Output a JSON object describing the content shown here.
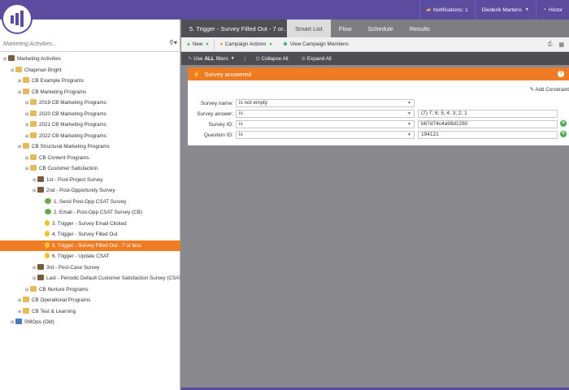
{
  "app": {
    "notifications_label": "Notifications: 1",
    "user_name": "Diederik Martens",
    "history_label": "Histor"
  },
  "left": {
    "search_placeholder": "Marketing Activities...",
    "tree": [
      {
        "label": "Marketing Activities",
        "indent": 0,
        "icon": "root"
      },
      {
        "label": "Chapman Bright",
        "indent": 1,
        "icon": "folder"
      },
      {
        "label": "CB Example Programs",
        "indent": 2,
        "icon": "folder"
      },
      {
        "label": "CB Marketing Programs",
        "indent": 2,
        "icon": "folder"
      },
      {
        "label": "2019 CB Marketing Programs",
        "indent": 3,
        "icon": "folder"
      },
      {
        "label": "2020 CB Marketing Programs",
        "indent": 3,
        "icon": "folder"
      },
      {
        "label": "2021 CB Marketing Programs",
        "indent": 3,
        "icon": "folder"
      },
      {
        "label": "2022 CB Marketing Programs",
        "indent": 3,
        "icon": "folder"
      },
      {
        "label": "CB Structural Marketing Programs",
        "indent": 2,
        "icon": "folder"
      },
      {
        "label": "CB Content Programs",
        "indent": 3,
        "icon": "folder"
      },
      {
        "label": "CB Customer Satisfaction",
        "indent": 3,
        "icon": "folder"
      },
      {
        "label": "1st - Post-Project Survey",
        "indent": 4,
        "icon": "program"
      },
      {
        "label": "2nd - Post-Opportunity Survey",
        "indent": 4,
        "icon": "program"
      },
      {
        "label": "1. Send Post-Opp CSAT Survey",
        "indent": 5,
        "icon": "email"
      },
      {
        "label": "2. Email - Post-Opp CSAT Survey (CB)",
        "indent": 5,
        "icon": "email"
      },
      {
        "label": "3. Trigger - Survey Email Clicked",
        "indent": 5,
        "icon": "bulb"
      },
      {
        "label": "4. Trigger - Survey Filled Out",
        "indent": 5,
        "icon": "bulb"
      },
      {
        "label": "5. Trigger - Survey Filled Out - 7 or less",
        "indent": 5,
        "icon": "bulb",
        "selected": true
      },
      {
        "label": "6. Trigger - Update CSAT",
        "indent": 5,
        "icon": "bulb"
      },
      {
        "label": "3rd - Post-Case Survey",
        "indent": 4,
        "icon": "program"
      },
      {
        "label": "Last - Periodic Default Customer Satisfaction Survey (CSAT)",
        "indent": 4,
        "icon": "program"
      },
      {
        "label": "CB Nurture Programs",
        "indent": 3,
        "icon": "folder"
      },
      {
        "label": "CB Operational Programs",
        "indent": 2,
        "icon": "folder"
      },
      {
        "label": "CB Test & Learning",
        "indent": 2,
        "icon": "folder"
      },
      {
        "label": "SMOps (Old)",
        "indent": 1,
        "icon": "folder-blue"
      }
    ]
  },
  "tabs": [
    {
      "label": "5. Trigger - Survey Filled Out - 7 or...",
      "active": false
    },
    {
      "label": "Smart List",
      "active": true
    },
    {
      "label": "Flow",
      "active": false
    },
    {
      "label": "Schedule",
      "active": false
    },
    {
      "label": "Results",
      "active": false
    }
  ],
  "toolbar": {
    "new_label": "New",
    "campaign_actions_label": "Campaign Actions",
    "view_members_label": "View Campaign Members"
  },
  "filterbar": {
    "use_all_filters_prefix": "Use",
    "use_all_filters_bold": "ALL",
    "use_all_filters_suffix": "filters",
    "separator": "|",
    "collapse_all": "Collapse All",
    "expand_all": "Expand All"
  },
  "filter": {
    "title": "Survey answered",
    "add_constraint": "Add Constraint",
    "rows": [
      {
        "label": "Survey name:",
        "operator": "is not empty",
        "value": ""
      },
      {
        "label": "Survey answer:",
        "operator": "is",
        "value": "(7) 7; 6; 5; 4; 3; 2; 1"
      },
      {
        "label": "Survey ID:",
        "operator": "is",
        "value": "b67d74c4a99d1260"
      },
      {
        "label": "Question ID:",
        "operator": "is",
        "value": "194121"
      }
    ]
  },
  "colors": {
    "brand_purple": "#5c4c9f",
    "accent_orange": "#ef7c23",
    "selected_row": "#ee7d23"
  }
}
